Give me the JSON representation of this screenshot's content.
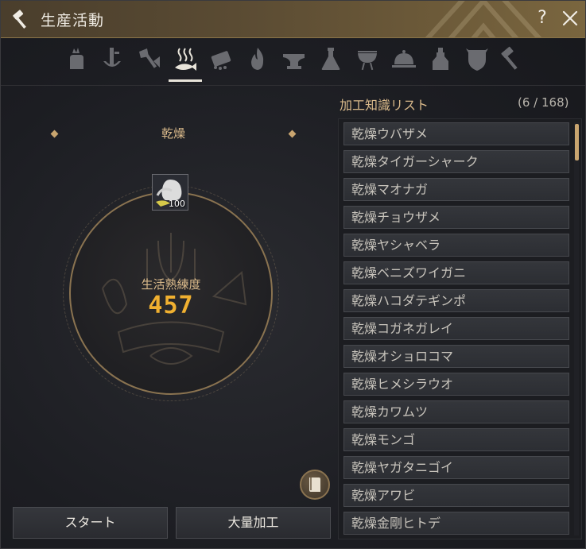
{
  "window": {
    "title": "生産活動",
    "help_label": "?",
    "colors": {
      "accent": "#c9a56f",
      "title_bar": "#5a4b33",
      "skill_value": "#f0b030"
    }
  },
  "tabs": [
    {
      "name": "gathering",
      "icon": "gathering-hand-icon",
      "active": false
    },
    {
      "name": "alchemy-tools",
      "icon": "tool-icon",
      "active": false
    },
    {
      "name": "chopping",
      "icon": "axe-icon",
      "active": false
    },
    {
      "name": "drying",
      "icon": "steaming-fish-icon",
      "active": true
    },
    {
      "name": "grinding",
      "icon": "grinder-icon",
      "active": false
    },
    {
      "name": "heating",
      "icon": "flame-icon",
      "active": false
    },
    {
      "name": "anvil",
      "icon": "anvil-icon",
      "active": false
    },
    {
      "name": "alchemy",
      "icon": "flask-icon",
      "active": false
    },
    {
      "name": "grill",
      "icon": "grill-icon",
      "active": false
    },
    {
      "name": "cooking",
      "icon": "cloche-icon",
      "active": false
    },
    {
      "name": "imperial-alchemy",
      "icon": "potion-icon",
      "active": false
    },
    {
      "name": "imperial-delivery",
      "icon": "emblem-icon",
      "active": false
    },
    {
      "name": "crafting",
      "icon": "hammer-icon",
      "active": false
    }
  ],
  "left": {
    "category": "乾燥",
    "skill_label": "生活熟練度",
    "skill_value": "457",
    "item_quantity": "100",
    "start_label": "スタート",
    "mass_label": "大量加工"
  },
  "list": {
    "header": "加工知識リスト",
    "count": "(6 / 168)",
    "items": [
      "乾燥ウバザメ",
      "乾燥タイガーシャーク",
      "乾燥マオナガ",
      "乾燥チョウザメ",
      "乾燥ヤシャベラ",
      "乾燥ベニズワイガニ",
      "乾燥ハコダテギンポ",
      "乾燥コガネガレイ",
      "乾燥オショロコマ",
      "乾燥ヒメシラウオ",
      "乾燥カワムツ",
      "乾燥モンゴ",
      "乾燥ヤガタニゴイ",
      "乾燥アワビ",
      "乾燥金剛ヒトデ"
    ]
  }
}
